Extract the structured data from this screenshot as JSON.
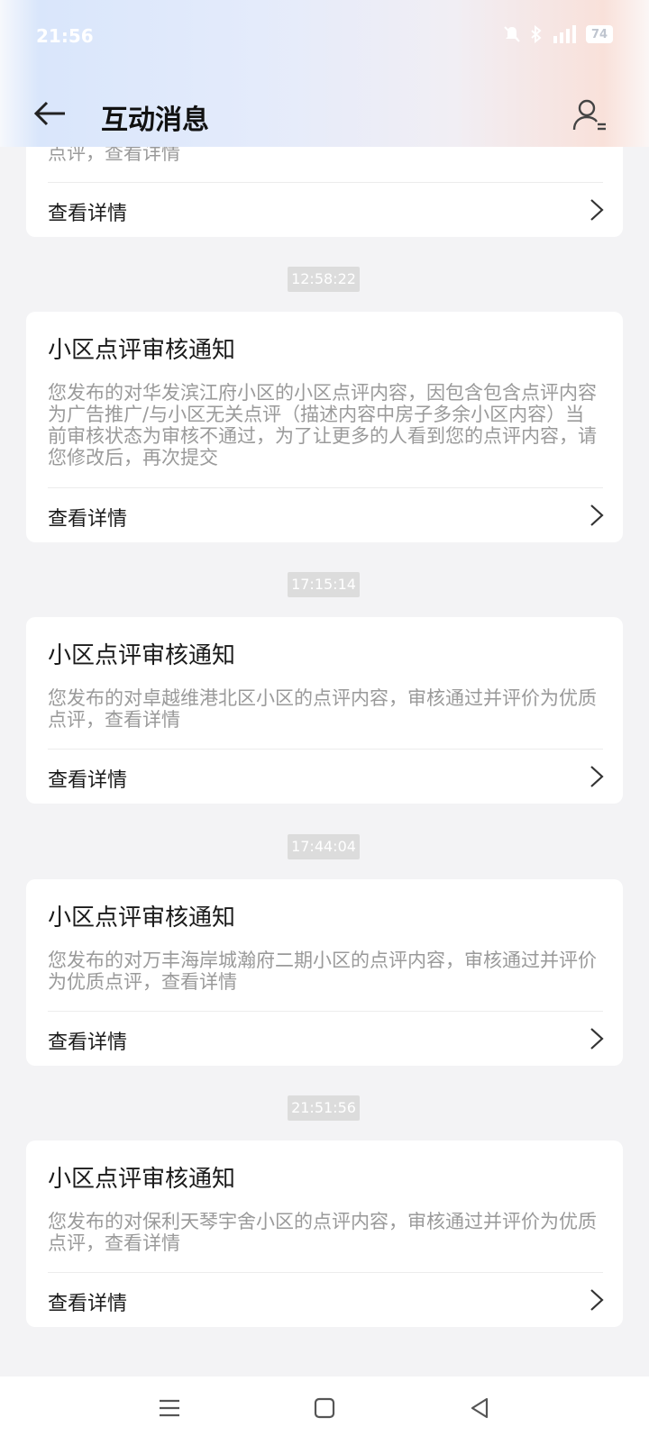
{
  "status_bar": {
    "time": "21:56",
    "battery": "74"
  },
  "header": {
    "title": "互动消息"
  },
  "partial_card": {
    "body_tail": "点评，查看详情",
    "detail_label": "查看详情"
  },
  "messages": [
    {
      "timestamp": "12:58:22",
      "title": "小区点评审核通知",
      "body": "您发布的对华发滨江府小区的小区点评内容，因包含包含点评内容为广告推广/与小区无关点评（描述内容中房子多余小区内容）当前审核状态为审核不通过，为了让更多的人看到您的点评内容，请您修改后，再次提交",
      "detail_label": "查看详情"
    },
    {
      "timestamp": "17:15:14",
      "title": "小区点评审核通知",
      "body": "您发布的对卓越维港北区小区的点评内容，审核通过并评价为优质点评，查看详情",
      "detail_label": "查看详情"
    },
    {
      "timestamp": "17:44:04",
      "title": "小区点评审核通知",
      "body": "您发布的对万丰海岸城瀚府二期小区的点评内容，审核通过并评价为优质点评，查看详情",
      "detail_label": "查看详情"
    },
    {
      "timestamp": "21:51:56",
      "title": "小区点评审核通知",
      "body": "您发布的对保利天琴宇舍小区的点评内容，审核通过并评价为优质点评，查看详情",
      "detail_label": "查看详情"
    }
  ],
  "icons": {
    "back": "arrow-left-icon",
    "user": "user-settings-icon",
    "chevron": "chevron-right-icon",
    "nav_menu": "menu-icon",
    "nav_home": "home-square-icon",
    "nav_back": "triangle-back-icon"
  }
}
